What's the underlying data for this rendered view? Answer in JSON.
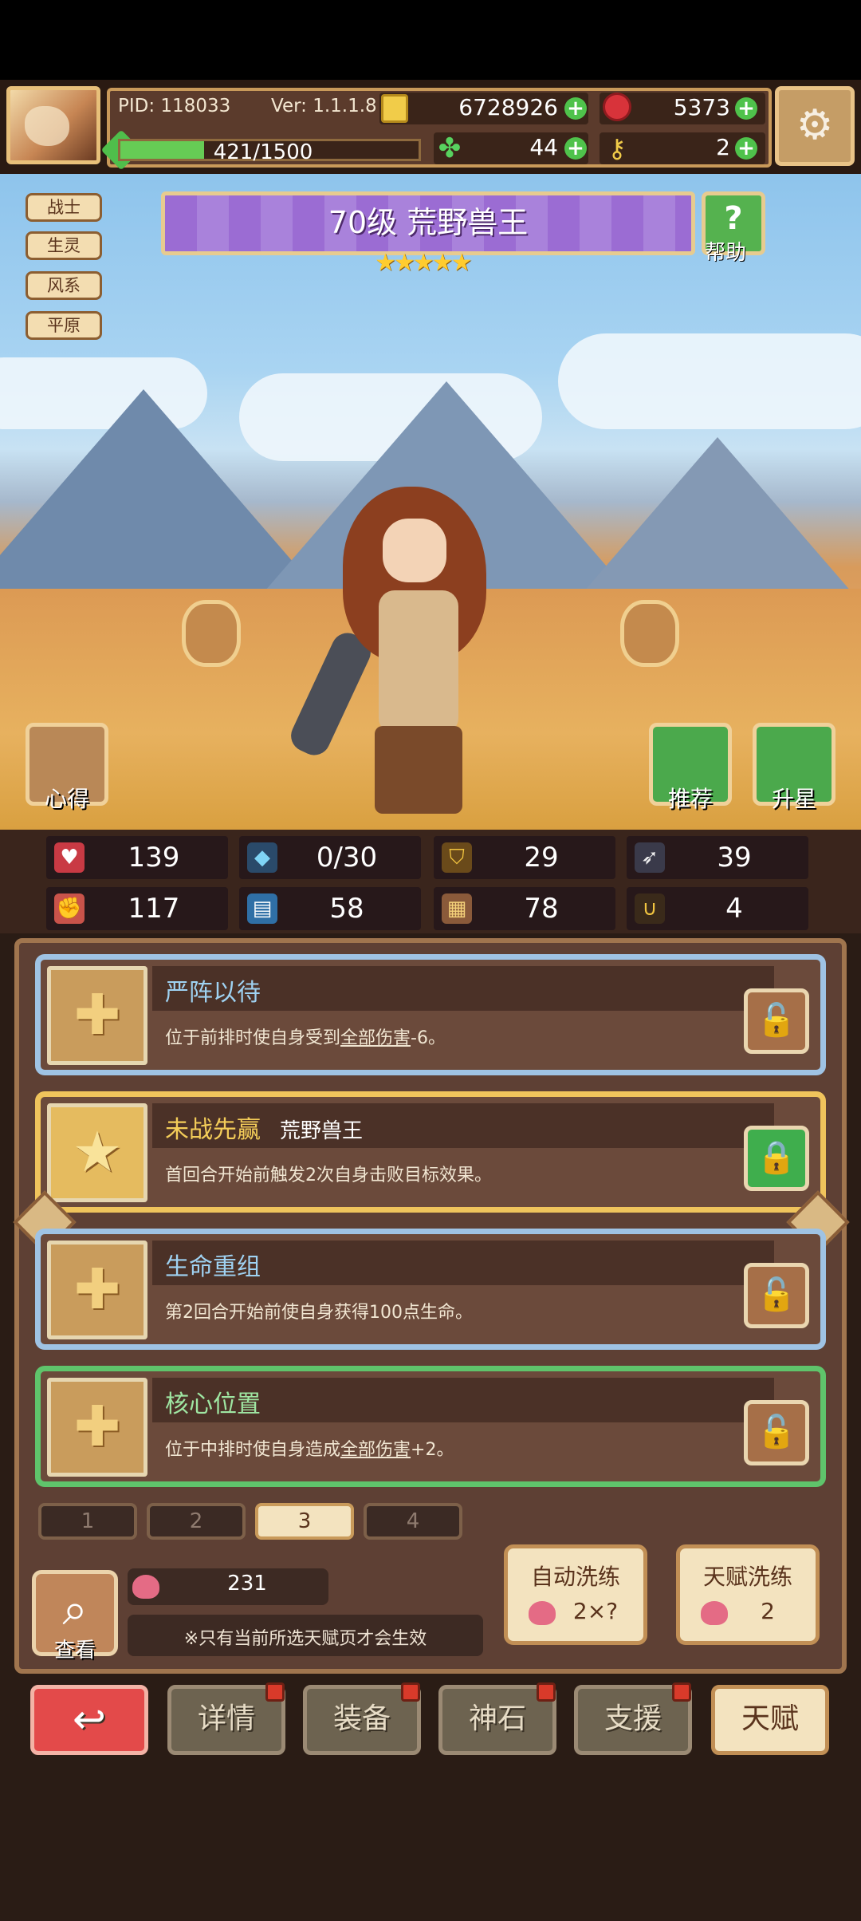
{
  "header": {
    "pid": "PID: 118033",
    "version": "Ver: 1.1.1.8",
    "coins": "6728926",
    "gems": "5373",
    "energy_text": "421/1500",
    "energy_fraction": 0.28,
    "clovers": "44",
    "keys": "2"
  },
  "tags": [
    "战士",
    "生灵",
    "风系",
    "平原"
  ],
  "hero": {
    "title": "70级 荒野兽王",
    "stars": 5,
    "help_label": "帮助",
    "left_button_label": "心得",
    "recommend_label": "推荐",
    "upgrade_label": "升星"
  },
  "stats": [
    {
      "icon": "heart-icon",
      "value": "139"
    },
    {
      "icon": "drop-icon",
      "value": "0/30"
    },
    {
      "icon": "shield-icon",
      "value": "29"
    },
    {
      "icon": "wing-icon",
      "value": "39"
    },
    {
      "icon": "fist-icon",
      "value": "117"
    },
    {
      "icon": "book-icon",
      "value": "58"
    },
    {
      "icon": "card-icon",
      "value": "78"
    },
    {
      "icon": "magnet-icon",
      "value": "4"
    }
  ],
  "talents": [
    {
      "name": "严阵以待",
      "sub": "",
      "desc_pre": "位于前排时使自身受到",
      "desc_link": "全部伤害",
      "desc_post": "-6。"
    },
    {
      "name": "未战先赢",
      "sub": "荒野兽王",
      "desc_pre": "首回合开始前触发2次自身击败目标效果。",
      "desc_link": "",
      "desc_post": ""
    },
    {
      "name": "生命重组",
      "sub": "",
      "desc_pre": "第2回合开始前使自身获得100点生命。",
      "desc_link": "",
      "desc_post": ""
    },
    {
      "name": "核心位置",
      "sub": "",
      "desc_pre": "位于中排时使自身造成",
      "desc_link": "全部伤害",
      "desc_post": "+2。"
    }
  ],
  "pages": [
    "1",
    "2",
    "3",
    "4"
  ],
  "bottom": {
    "search_label": "查看",
    "points": "231",
    "notice": "※只有当前所选天赋页才会生效",
    "auto_reroll_label": "自动洗练",
    "auto_reroll_cost": "2×?",
    "talent_reroll_label": "天赋洗练",
    "talent_reroll_cost": "2"
  },
  "nav": [
    "详情",
    "装备",
    "神石",
    "支援",
    "天赋"
  ],
  "colors": {
    "accent_green": "#4fc24b",
    "purple_banner": "#9b6cd3",
    "panel_brown": "#5e4034"
  }
}
